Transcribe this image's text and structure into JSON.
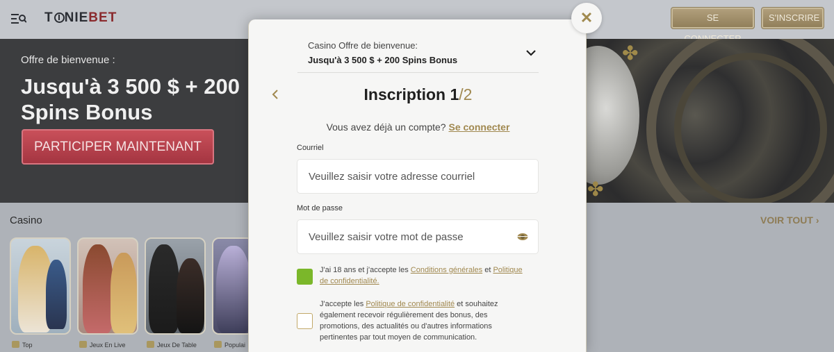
{
  "header": {
    "logo_pre": "T",
    "logo_mid": "NIE",
    "logo_brand": "BET",
    "login_label": "SE CONNECTER",
    "signup_label": "S'INSCRIRE"
  },
  "hero": {
    "kicker": "Offre de bienvenue :",
    "title_line1": "Jusqu'à 3 500 $ + 200",
    "title_line2": "Spins Bonus",
    "cta_label": "PARTICIPER MAINTENANT"
  },
  "casino": {
    "section_title": "Casino",
    "see_all_label": "VOIR TOUT",
    "categories": [
      "Top",
      "Jeux En Live",
      "Jeux De Table",
      "Populai"
    ]
  },
  "modal": {
    "close_label": "✕",
    "offer_kicker": "Casino Offre de bienvenue:",
    "offer_main": "Jusqu'à 3 500 $ + 200 Spins Bonus",
    "title": "Inscription 1",
    "step_suffix": "/2",
    "have_account_text": "Vous avez déjà un compte?",
    "have_account_link": "Se connecter",
    "email_label": "Courriel",
    "email_placeholder": "Veuillez saisir votre adresse courriel",
    "password_label": "Mot de passe",
    "password_placeholder": "Veuillez saisir votre mot de passe",
    "consent1_pre": "J'ai 18 ans et j'accepte les ",
    "consent1_link1": "Conditions générales",
    "consent1_mid": " et ",
    "consent1_link2": "Politique de confidentialité.",
    "consent1_checked": true,
    "consent2_pre": "J'accepte les ",
    "consent2_link": "Politique de confidentialité",
    "consent2_post": " et souhaitez également recevoir régulièrement des bonus, des promotions, des actualités ou d'autres informations pertinentes par tout moyen de communication.",
    "consent2_checked": false
  },
  "colors": {
    "gold_accent": "#a0884f",
    "checkbox_green": "#7bb72a",
    "cta_red": "#b8404c"
  }
}
